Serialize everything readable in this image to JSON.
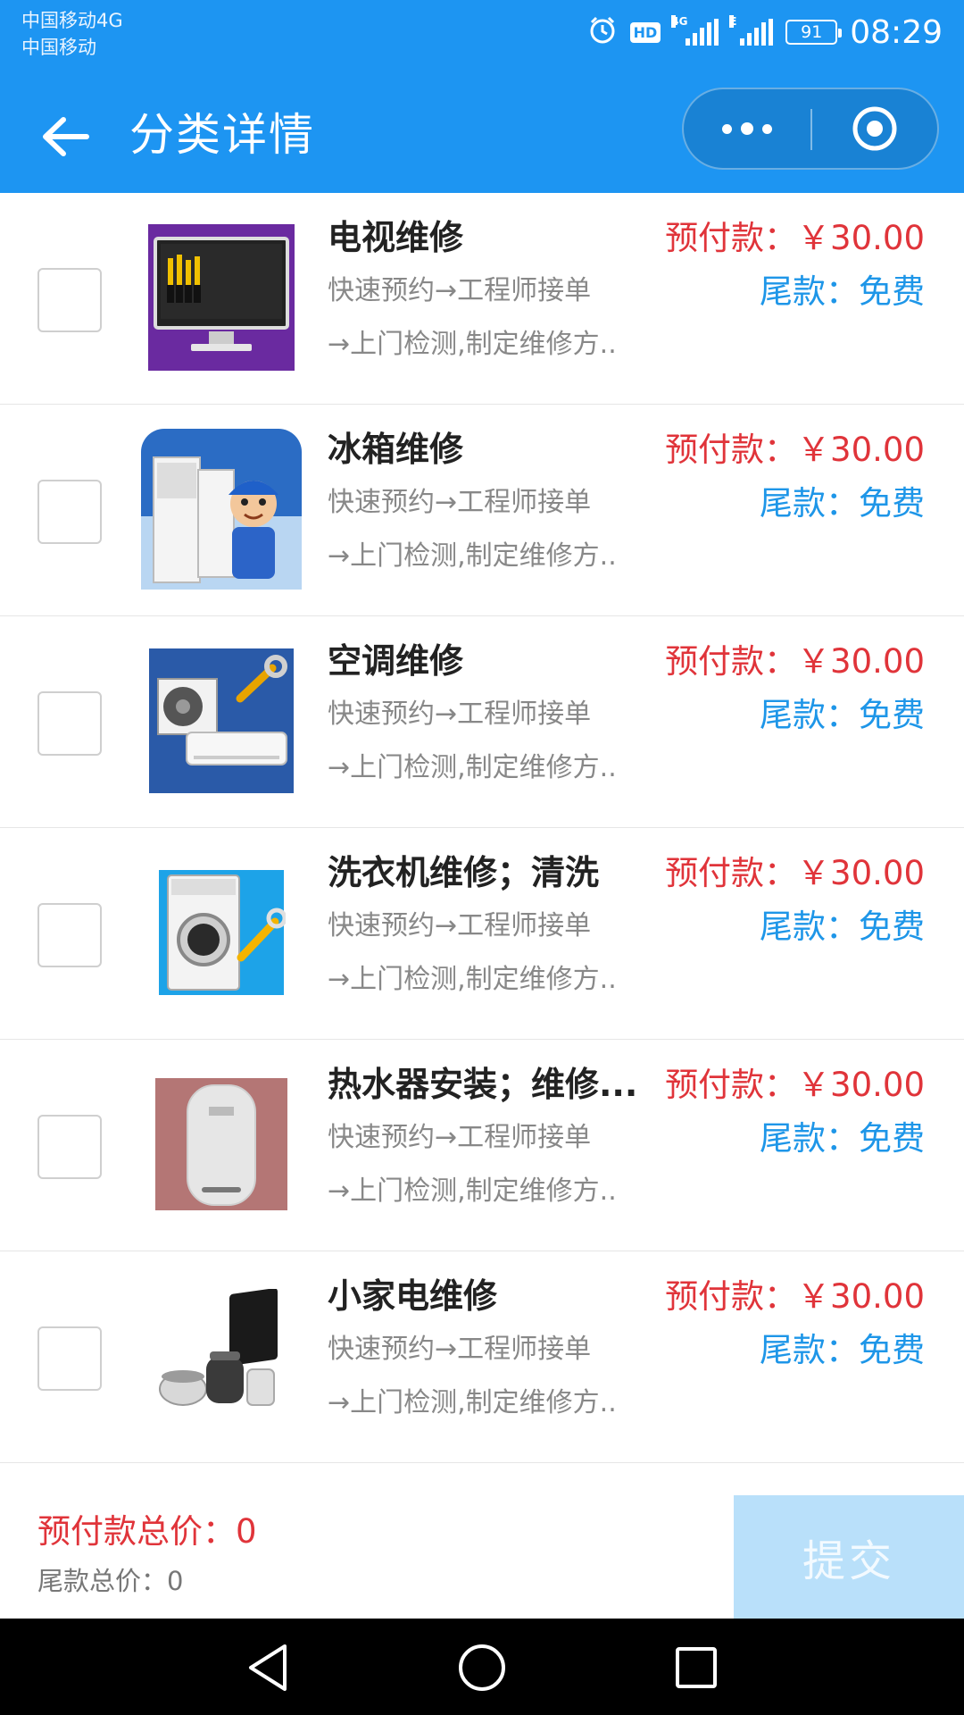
{
  "status": {
    "carrier_1": "中国移动4G",
    "carrier_2": "中国移动",
    "network_tag_1": "4G",
    "network_tag_2": "E",
    "hd": "HD",
    "battery": "91",
    "time": "08:29",
    "icons": [
      "alarm-icon",
      "hd-icon",
      "signal-icon",
      "signal-icon",
      "battery-icon"
    ]
  },
  "nav": {
    "title": "分类详情",
    "icons": [
      "back-arrow-icon",
      "more-dots-icon",
      "close-target-icon"
    ]
  },
  "items": [
    {
      "name": "电视维修",
      "desc1": "快速预约→工程师接单",
      "desc2": "→上门检测,制定维修方..",
      "prepay": "预付款：￥30.00",
      "tail": "尾款：免费",
      "image": "tv-repair-image"
    },
    {
      "name": "冰箱维修",
      "desc1": "快速预约→工程师接单",
      "desc2": "→上门检测,制定维修方..",
      "prepay": "预付款：￥30.00",
      "tail": "尾款：免费",
      "image": "fridge-repair-image"
    },
    {
      "name": "空调维修",
      "desc1": "快速预约→工程师接单",
      "desc2": "→上门检测,制定维修方..",
      "prepay": "预付款：￥30.00",
      "tail": "尾款：免费",
      "image": "ac-repair-image"
    },
    {
      "name": "洗衣机维修；清洗",
      "desc1": "快速预约→工程师接单",
      "desc2": "→上门检测,制定维修方..",
      "prepay": "预付款：￥30.00",
      "tail": "尾款：免费",
      "image": "washer-repair-image"
    },
    {
      "name": "热水器安装；维修...",
      "desc1": "快速预约→工程师接单",
      "desc2": "→上门检测,制定维修方..",
      "prepay": "预付款：￥30.00",
      "tail": "尾款：免费",
      "image": "water-heater-image"
    },
    {
      "name": "小家电维修",
      "desc1": "快速预约→工程师接单",
      "desc2": "→上门检测,制定维修方..",
      "prepay": "预付款：￥30.00",
      "tail": "尾款：免费",
      "image": "small-appliance-image"
    }
  ],
  "summary": {
    "prepay_total": "预付款总价：0",
    "tail_total": "尾款总价：0",
    "submit_label": "提交"
  },
  "colors": {
    "primary": "#1d95f2",
    "prepay": "#e0343a",
    "tail": "#1e96e8",
    "submit_bg": "#b9e0fa"
  }
}
